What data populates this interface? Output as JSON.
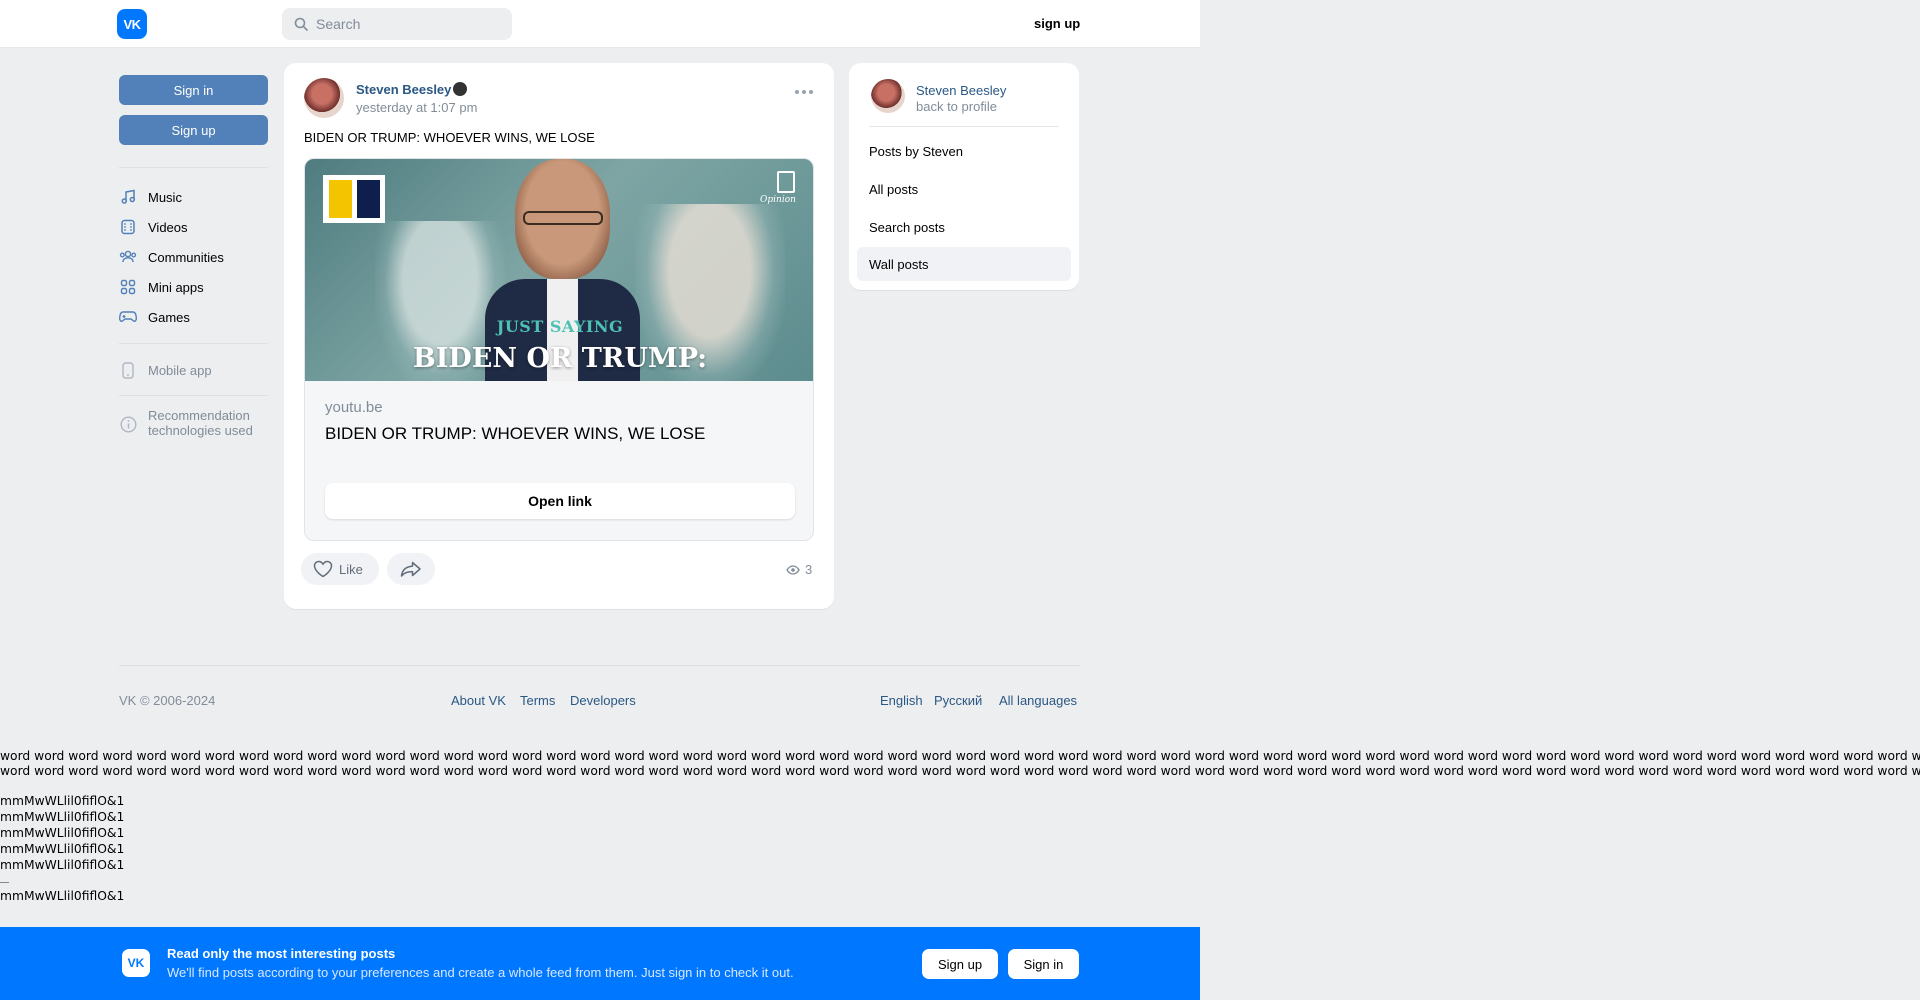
{
  "header": {
    "logo": "VK",
    "search_placeholder": "Search",
    "signup": "sign up"
  },
  "sidebar": {
    "sign_in": "Sign in",
    "sign_up": "Sign up",
    "items": [
      {
        "label": "Music",
        "icon": "music-icon"
      },
      {
        "label": "Videos",
        "icon": "videos-icon"
      },
      {
        "label": "Communities",
        "icon": "communities-icon"
      },
      {
        "label": "Mini apps",
        "icon": "mini-apps-icon"
      },
      {
        "label": "Games",
        "icon": "games-icon"
      }
    ],
    "mobile_app": "Mobile app",
    "recommendation_line1": "Recommendation",
    "recommendation_line2": "technologies used"
  },
  "post": {
    "author": "Steven Beesley",
    "time": "yesterday at 1:07 pm",
    "text": "BIDEN OR TRUMP: WHOEVER WINS, WE LOSE",
    "thumbnail": {
      "badge": "Opinion",
      "kicker": "JUST SAYING",
      "headline": "BIDEN OR TRUMP:"
    },
    "link_domain": "youtu.be",
    "link_title": "BIDEN OR TRUMP: WHOEVER WINS, WE LOSE",
    "open_link": "Open link",
    "like": "Like",
    "views": "3"
  },
  "right_card": {
    "name": "Steven Beesley",
    "back": "back to profile",
    "items": [
      "Posts by Steven",
      "All posts",
      "Search posts",
      "Wall posts"
    ],
    "active_index": 3
  },
  "footer": {
    "copyright": "VK © 2006-2024",
    "about": "About VK",
    "terms": "Terms",
    "developers": "Developers",
    "english": "English",
    "russian": "Русский",
    "all_languages": "All languages"
  },
  "test_text": {
    "words_line": "word word word word word word word word word word word word word word word word word word word word word word word word word word word word word word word word word word word word word word word word word word word word word word word word word word word word word word word word word word word word word word word word",
    "m_line": "mmMwWLlil0fiflO&1"
  },
  "banner": {
    "logo": "VK",
    "title": "Read only the most interesting posts",
    "subtitle": "We'll find posts according to your preferences and create a whole feed from them. Just sign in to check it out.",
    "sign_up": "Sign up",
    "sign_in": "Sign in"
  },
  "colors": {
    "vk_blue": "#0077ff",
    "button_blue": "#5181b8",
    "link": "#2a5885",
    "muted": "#818c99",
    "background": "#edeef0"
  }
}
